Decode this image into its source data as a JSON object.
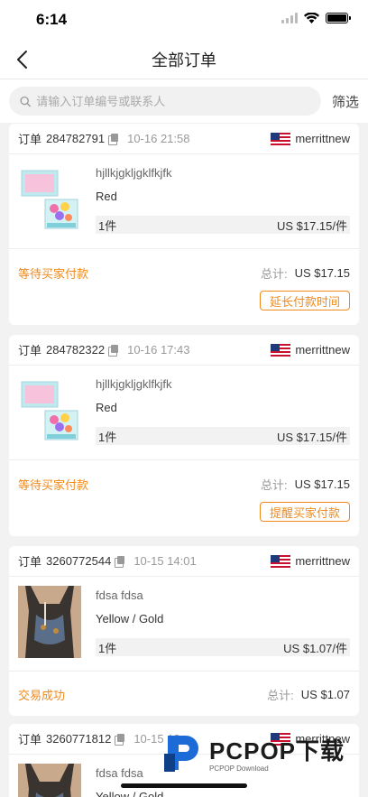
{
  "status_bar": {
    "time": "6:14"
  },
  "nav": {
    "title": "全部订单"
  },
  "search": {
    "placeholder": "请输入订单编号或联系人",
    "filter_label": "筛选"
  },
  "orders": [
    {
      "label": "订单",
      "order_no": "284782791",
      "time": "10-16 21:58",
      "seller": "merrittnew",
      "item": {
        "name": "hjllkjgkljgklfkjfk",
        "spec": "Red",
        "qty": "1件",
        "price": "US $17.15/件"
      },
      "status": "等待买家付款",
      "total_label": "总计:",
      "total": "US $17.15",
      "action": "延长付款时间"
    },
    {
      "label": "订单",
      "order_no": "284782322",
      "time": "10-16 17:43",
      "seller": "merrittnew",
      "item": {
        "name": "hjllkjgkljgklfkjfk",
        "spec": "Red",
        "qty": "1件",
        "price": "US $17.15/件"
      },
      "status": "等待买家付款",
      "total_label": "总计:",
      "total": "US $17.15",
      "action": "提醒买家付款"
    },
    {
      "label": "订单",
      "order_no": "3260772544",
      "time": "10-15 14:01",
      "seller": "merrittnew",
      "item": {
        "name": "fdsa fdsa",
        "spec": "Yellow / Gold",
        "qty": "1件",
        "price": "US $1.07/件"
      },
      "status": "交易成功",
      "total_label": "总计:",
      "total": "US $1.07",
      "action": ""
    },
    {
      "label": "订单",
      "order_no": "3260771812",
      "time": "10-15 13:",
      "seller": "merrittnew",
      "item": {
        "name": "fdsa fdsa",
        "spec": "Yellow / Gold",
        "qty": "",
        "price": ""
      },
      "status": "",
      "total_label": "",
      "total": "",
      "action": ""
    }
  ],
  "watermark": {
    "main": "PCPOP下载",
    "sub": "PCPOP Download"
  },
  "colors": {
    "accent": "#f08a1c",
    "background": "#f2f2f2"
  },
  "icons": [
    "back-arrow-icon",
    "search-icon",
    "copy-icon",
    "us-flag-icon",
    "wifi-icon",
    "battery-icon",
    "signal-icon"
  ]
}
